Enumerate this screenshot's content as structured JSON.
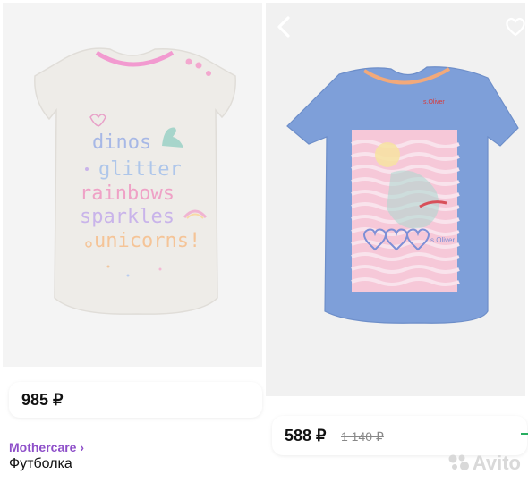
{
  "left_listing": {
    "print_lines": [
      "dinos",
      "glitter",
      "rainbows",
      "sparkles",
      "unicorns!"
    ],
    "price": "985 ₽",
    "brand": "Mothercare ›",
    "product_type": "Футболка"
  },
  "right_listing": {
    "print_brand": "s.Oliver",
    "price": "588 ₽",
    "old_price": "1 140 ₽"
  },
  "watermark": "Avito",
  "colors": {
    "brand_link": "#8e4fc9",
    "left_shirt": "#efedea",
    "right_shirt": "#7e9fd9"
  }
}
